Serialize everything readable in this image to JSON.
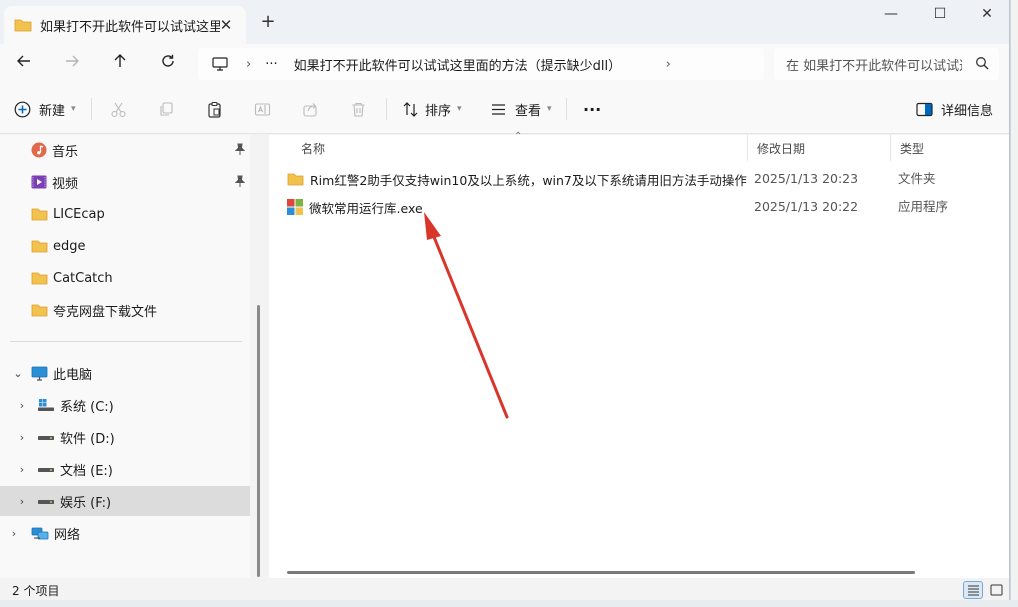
{
  "tab": {
    "title": "如果打不开此软件可以试试这里面的方法（提示缺少dll）",
    "close_icon": "close-icon",
    "new_tab": "+"
  },
  "window_controls": {
    "minimize": "—",
    "maximize": "☐",
    "close": "✕"
  },
  "address": {
    "ellipsis": "···",
    "path": "如果打不开此软件可以试试这里面的方法（提示缺少dll）",
    "chevron": "›"
  },
  "search": {
    "placeholder": "在 如果打不开此软件可以试试这里面的方法（提示缺少dll） 中搜索"
  },
  "commands": {
    "new_label": "新建",
    "sort_label": "排序",
    "view_label": "查看",
    "more": "···",
    "details_label": "详细信息"
  },
  "nav": {
    "quick_access": [
      {
        "label": "音乐",
        "icon": "music-icon",
        "pinned": true
      },
      {
        "label": "视频",
        "icon": "video-icon",
        "pinned": true
      },
      {
        "label": "LICEcap",
        "icon": "folder-icon"
      },
      {
        "label": "edge",
        "icon": "folder-icon"
      },
      {
        "label": "CatCatch",
        "icon": "folder-icon"
      },
      {
        "label": "夸克网盘下载文件",
        "icon": "folder-icon"
      }
    ],
    "this_pc": "此电脑",
    "drives": [
      {
        "label": "系统 (C:)",
        "icon": "windows-drive-icon"
      },
      {
        "label": "软件 (D:)",
        "icon": "drive-icon"
      },
      {
        "label": "文档 (E:)",
        "icon": "drive-icon"
      },
      {
        "label": "娱乐 (F:)",
        "icon": "drive-icon",
        "selected": true
      }
    ],
    "network": "网络"
  },
  "columns": {
    "name": "名称",
    "modified": "修改日期",
    "type": "类型"
  },
  "files": [
    {
      "name": "Rim红警2助手仅支持win10及以上系统，win7及以下系统请用旧方法手动操作",
      "modified": "2025/1/13 20:23",
      "type": "文件夹",
      "icon": "folder-icon"
    },
    {
      "name": "微软常用运行库.exe",
      "modified": "2025/1/13 20:22",
      "type": "应用程序",
      "icon": "exe-installer-icon"
    }
  ],
  "status": {
    "item_count": "2 个项目"
  },
  "colors": {
    "accent": "#0067c0",
    "folder": "#f2c14e",
    "arrow": "#d9362b",
    "selected": "#dcdcdc"
  }
}
